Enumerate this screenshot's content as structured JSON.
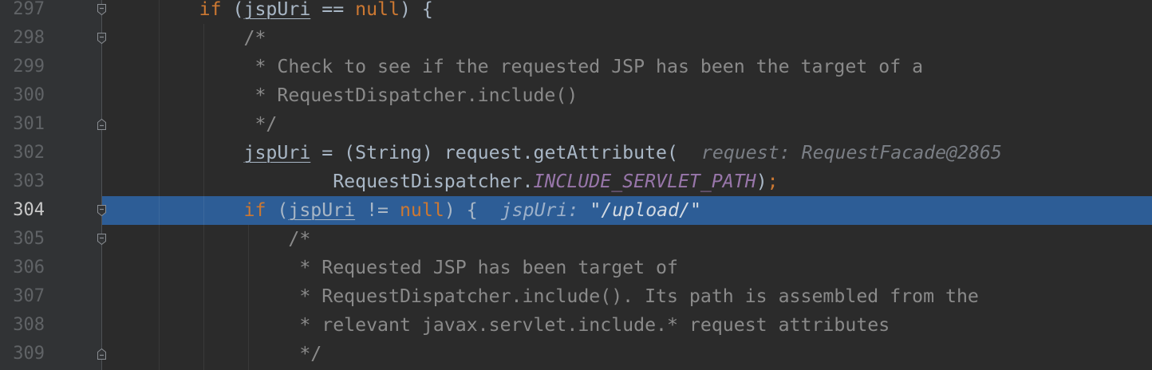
{
  "editor": {
    "lines": [
      {
        "number": "297",
        "fold_icon": "fold-start-icon",
        "tokens": [
          "if",
          " (",
          "jspUri",
          " == ",
          "null",
          ") {"
        ]
      },
      {
        "number": "298",
        "fold_icon": "fold-start-icon",
        "tokens": [
          "/*"
        ]
      },
      {
        "number": "299",
        "tokens": [
          "* Check to see if the requested JSP has been the target of a"
        ]
      },
      {
        "number": "300",
        "tokens": [
          "* RequestDispatcher.include()"
        ]
      },
      {
        "number": "301",
        "fold_icon": "fold-end-icon",
        "tokens": [
          "*/"
        ]
      },
      {
        "number": "302",
        "tokens": [
          "jspUri",
          " = (String) request.getAttribute("
        ],
        "inline_value": {
          "name": "request:",
          "value": "RequestFacade@2865"
        }
      },
      {
        "number": "303",
        "tokens": [
          "RequestDispatcher",
          ".",
          "INCLUDE_SERVLET_PATH",
          ")",
          ";"
        ]
      },
      {
        "number": "304",
        "fold_icon": "fold-start-icon",
        "execution_point": true,
        "tokens": [
          "if",
          " (",
          "jspUri",
          " != ",
          "null",
          ") {"
        ],
        "inline_value": {
          "name": "jspUri:",
          "value": "\"/upload/\""
        }
      },
      {
        "number": "305",
        "fold_icon": "fold-start-icon",
        "tokens": [
          "/*"
        ]
      },
      {
        "number": "306",
        "tokens": [
          "* Requested JSP has been target of"
        ]
      },
      {
        "number": "307",
        "tokens": [
          "* RequestDispatcher.include(). Its path is assembled from the"
        ]
      },
      {
        "number": "308",
        "tokens": [
          "* relevant javax.servlet.include.* request attributes"
        ]
      },
      {
        "number": "309",
        "fold_icon": "fold-end-icon",
        "tokens": [
          "*/"
        ]
      }
    ]
  },
  "theme": {
    "editor_bg": "#2B2B2B",
    "gutter_bg": "#313335",
    "line_number": "#606366",
    "line_number_current": "#C9C9C9",
    "keyword": "#CC7832",
    "identifier": "#A9B7C6",
    "comment": "#8A8A8A",
    "static_field": "#9876AA",
    "inline_hint": "#7A7E85",
    "execution_line": "#2D5D96",
    "fold_icon": "#8A8E93",
    "hint_on_exec_name": "#9CB0C9",
    "hint_on_exec_value": "#D3DAE2"
  }
}
